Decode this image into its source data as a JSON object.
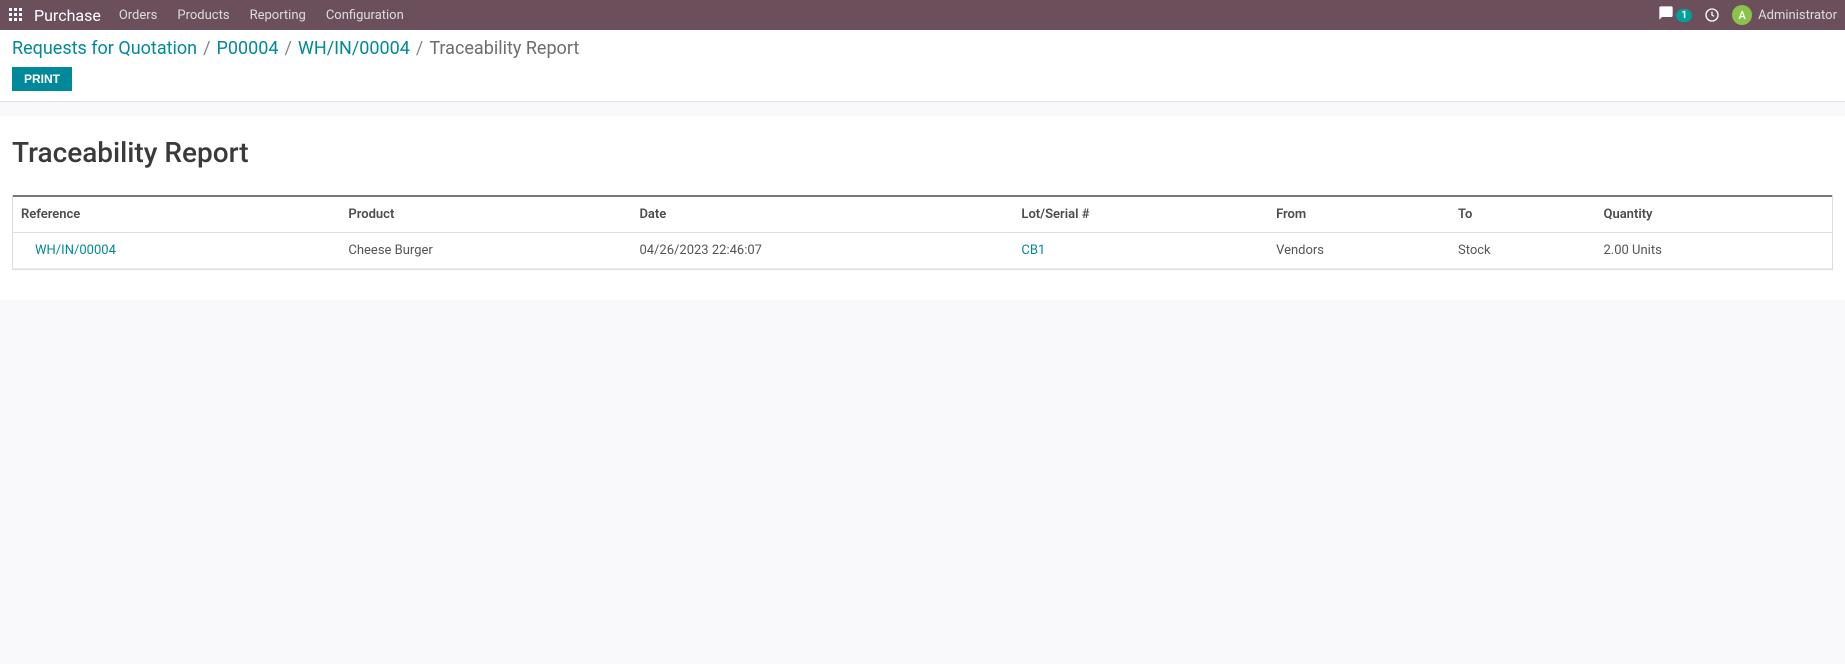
{
  "topbar": {
    "app_name": "Purchase",
    "nav": [
      "Orders",
      "Products",
      "Reporting",
      "Configuration"
    ],
    "msg_count": "1",
    "user_initial": "A",
    "user_name": "Administrator"
  },
  "breadcrumb": {
    "items": [
      "Requests for Quotation",
      "P00004",
      "WH/IN/00004"
    ],
    "current": "Traceability Report"
  },
  "actions": {
    "print_label": "Print"
  },
  "report": {
    "title": "Traceability Report",
    "columns": {
      "reference": "Reference",
      "product": "Product",
      "date": "Date",
      "lot": "Lot/Serial #",
      "from": "From",
      "to": "To",
      "quantity": "Quantity"
    },
    "rows": [
      {
        "reference": "WH/IN/00004",
        "product": "Cheese Burger",
        "date": "04/26/2023 22:46:07",
        "lot": "CB1",
        "from": "Vendors",
        "to": "Stock",
        "quantity": "2.00 Units"
      }
    ]
  }
}
